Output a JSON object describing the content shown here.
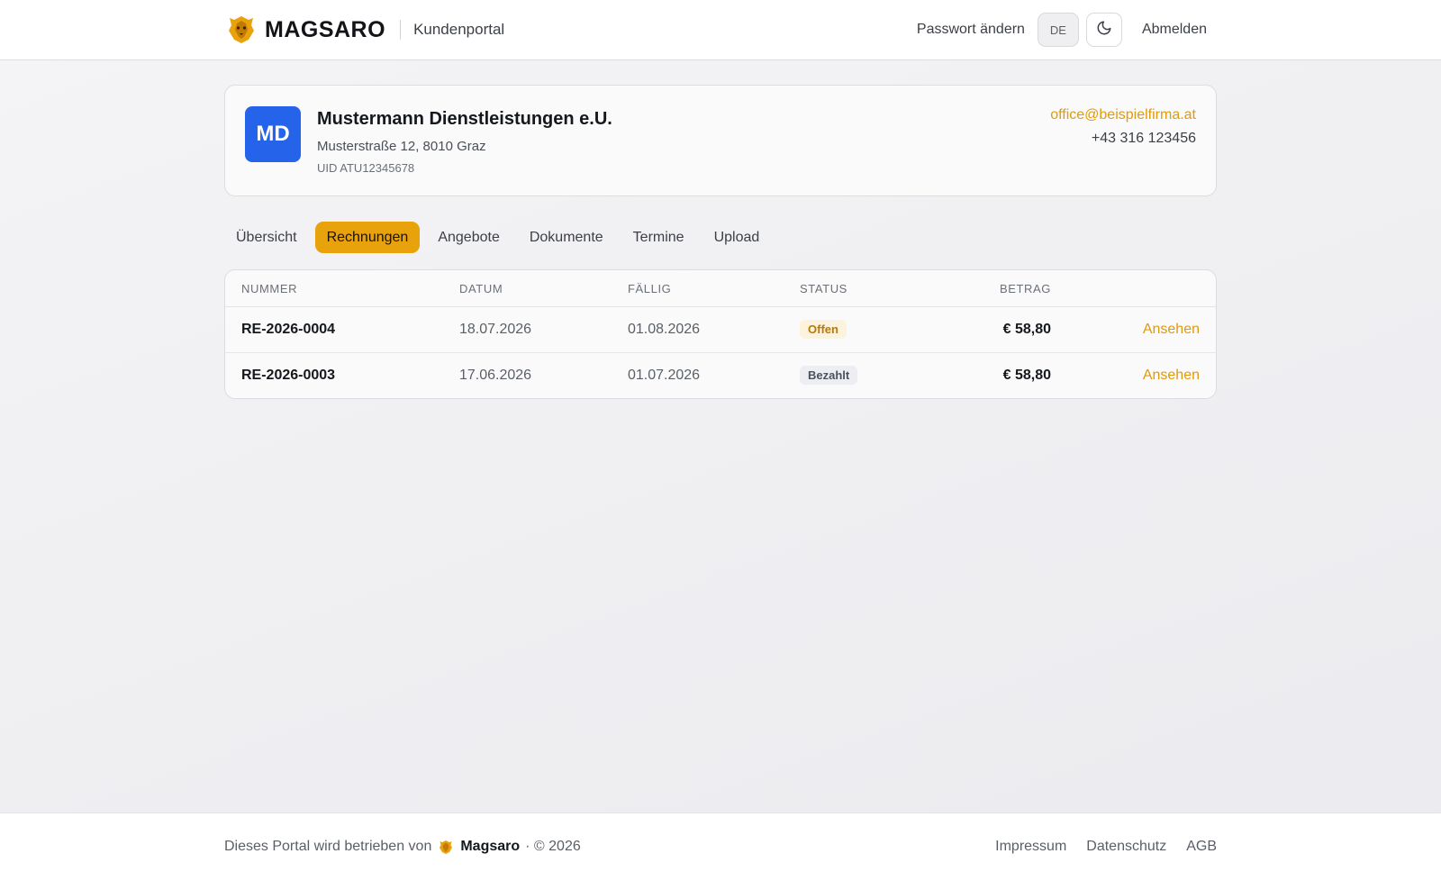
{
  "header": {
    "brand_name": "MAGSARO",
    "brand_sub": "Kundenportal",
    "change_password": "Passwort ändern",
    "lang": "DE",
    "logout": "Abmelden"
  },
  "customer": {
    "initials": "MD",
    "name": "Mustermann Dienstleistungen e.U.",
    "address": "Musterstraße 12, 8010 Graz",
    "uid": "UID ATU12345678",
    "email": "office@beispielfirma.at",
    "phone": "+43 316 123456",
    "avatar_color": "#2563eb"
  },
  "tabs": [
    {
      "label": "Übersicht"
    },
    {
      "label": "Rechnungen",
      "active": true
    },
    {
      "label": "Angebote"
    },
    {
      "label": "Dokumente"
    },
    {
      "label": "Termine"
    },
    {
      "label": "Upload"
    }
  ],
  "table": {
    "columns": [
      "Nummer",
      "Datum",
      "Fällig",
      "Status",
      "Betrag"
    ],
    "rows": [
      {
        "number": "RE-2026-0004",
        "date": "18.07.2026",
        "due": "01.08.2026",
        "status": "Offen",
        "amount": "€ 58,80",
        "action": "Ansehen"
      },
      {
        "number": "RE-2026-0003",
        "date": "17.06.2026",
        "due": "01.07.2026",
        "status": "Bezahlt",
        "amount": "€ 58,80",
        "action": "Ansehen"
      }
    ]
  },
  "footer": {
    "operated_by": "Dieses Portal wird betrieben von",
    "brand": "Magsaro",
    "copyright": "· © 2026",
    "links": [
      "Impressum",
      "Datenschutz",
      "AGB"
    ]
  },
  "colors": {
    "accent": "#e8a30c",
    "link": "#e09a0b"
  }
}
